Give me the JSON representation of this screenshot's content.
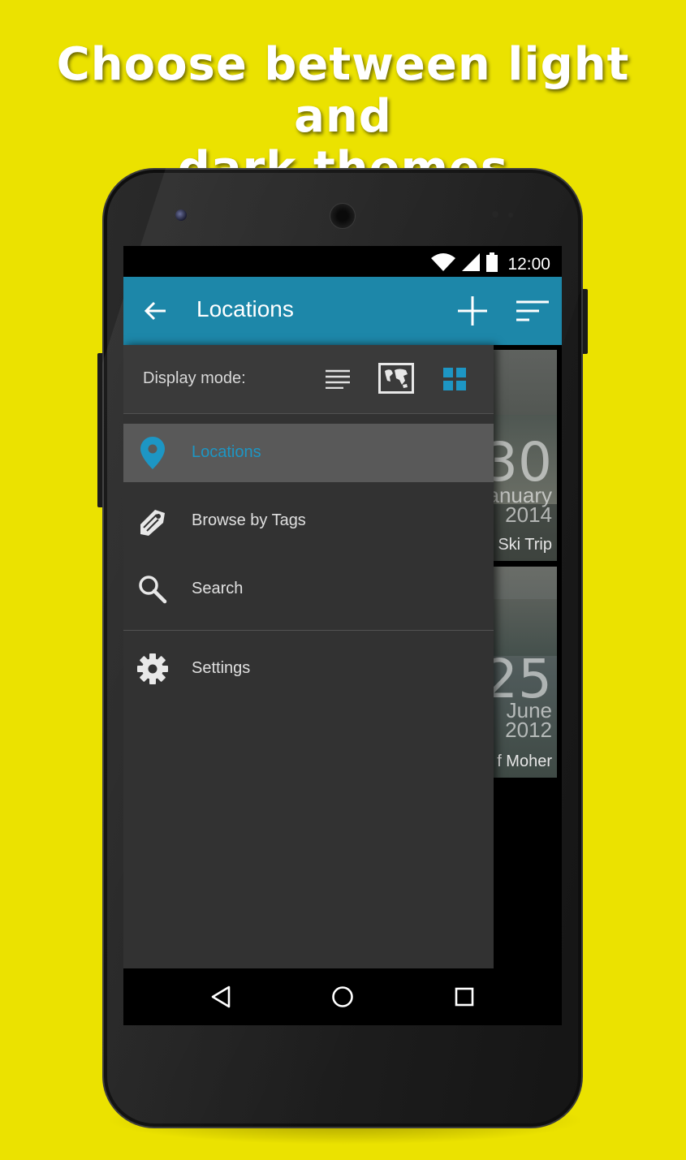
{
  "promo": {
    "headline_line1": "Choose between light and",
    "headline_line2": "dark themes"
  },
  "status_bar": {
    "time": "12:00",
    "icons": [
      "wifi-icon",
      "signal-icon",
      "battery-icon"
    ]
  },
  "app_bar": {
    "back_icon": "arrow-back-icon",
    "title": "Locations",
    "actions": [
      "add-icon",
      "sort-icon"
    ]
  },
  "drawer": {
    "display_mode_label": "Display mode:",
    "display_modes": [
      {
        "name": "list",
        "icon": "list-view-icon",
        "selected": false
      },
      {
        "name": "map",
        "icon": "map-view-icon",
        "selected": false
      },
      {
        "name": "grid",
        "icon": "grid-view-icon",
        "selected": true
      }
    ],
    "items": [
      {
        "label": "Locations",
        "icon": "location-pin-icon",
        "active": true
      },
      {
        "label": "Browse by Tags",
        "icon": "tag-icon",
        "active": false
      },
      {
        "label": "Search",
        "icon": "search-icon",
        "active": false
      },
      {
        "label": "Settings",
        "icon": "gear-icon",
        "active": false
      }
    ]
  },
  "cards": [
    {
      "day": "30",
      "month": "anuary",
      "year": "2014",
      "caption": "Ski Trip"
    },
    {
      "day": "25",
      "month": "June",
      "year": "2012",
      "caption": "f Moher"
    }
  ],
  "nav_bar": {
    "buttons": [
      "back-triangle-icon",
      "home-circle-icon",
      "recents-square-icon"
    ]
  },
  "colors": {
    "background": "#ebe200",
    "app_bar": "#1d87a9",
    "accent": "#1d96c4",
    "drawer": "#323232"
  }
}
